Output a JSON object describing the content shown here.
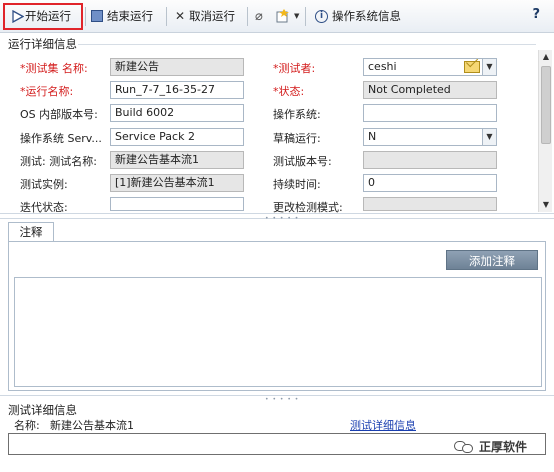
{
  "toolbar": {
    "start_run": "开始运行",
    "end_run": "结束运行",
    "cancel_run": "取消运行",
    "os_info": "操作系统信息",
    "help": "?"
  },
  "details": {
    "section_title": "运行详细信息",
    "fields": {
      "testset_name": {
        "label": "测试集 名称:",
        "value": "新建公告"
      },
      "tester": {
        "label": "测试者:",
        "value": "ceshi"
      },
      "run_name": {
        "label": "运行名称:",
        "value": "Run_7-7_16-35-27"
      },
      "status": {
        "label": "状态:",
        "value": "Not Completed"
      },
      "os_build": {
        "label": "OS 内部版本号:",
        "value": "Build 6002"
      },
      "os": {
        "label": "操作系统:",
        "value": ""
      },
      "os_service": {
        "label": "操作系统 Serv...",
        "value": "Service Pack 2"
      },
      "draft_run": {
        "label": "草稿运行:",
        "value": "N"
      },
      "test_name": {
        "label": "测试: 测试名称:",
        "value": "新建公告基本流1"
      },
      "test_version": {
        "label": "测试版本号:",
        "value": ""
      },
      "test_instance": {
        "label": "测试实例:",
        "value": "[1]新建公告基本流1"
      },
      "duration": {
        "label": "持续时间:",
        "value": "0"
      },
      "iteration_status": {
        "label": "迭代状态:",
        "value": ""
      },
      "change_detect": {
        "label": "更改检测模式:",
        "value": ""
      }
    }
  },
  "notes": {
    "tab_label": "注释",
    "add_button": "添加注释"
  },
  "test_details": {
    "title": "测试详细信息",
    "name_label": "名称:",
    "name_value": "新建公告基本流1",
    "link": "测试详细信息"
  },
  "watermark": "正厚软件"
}
